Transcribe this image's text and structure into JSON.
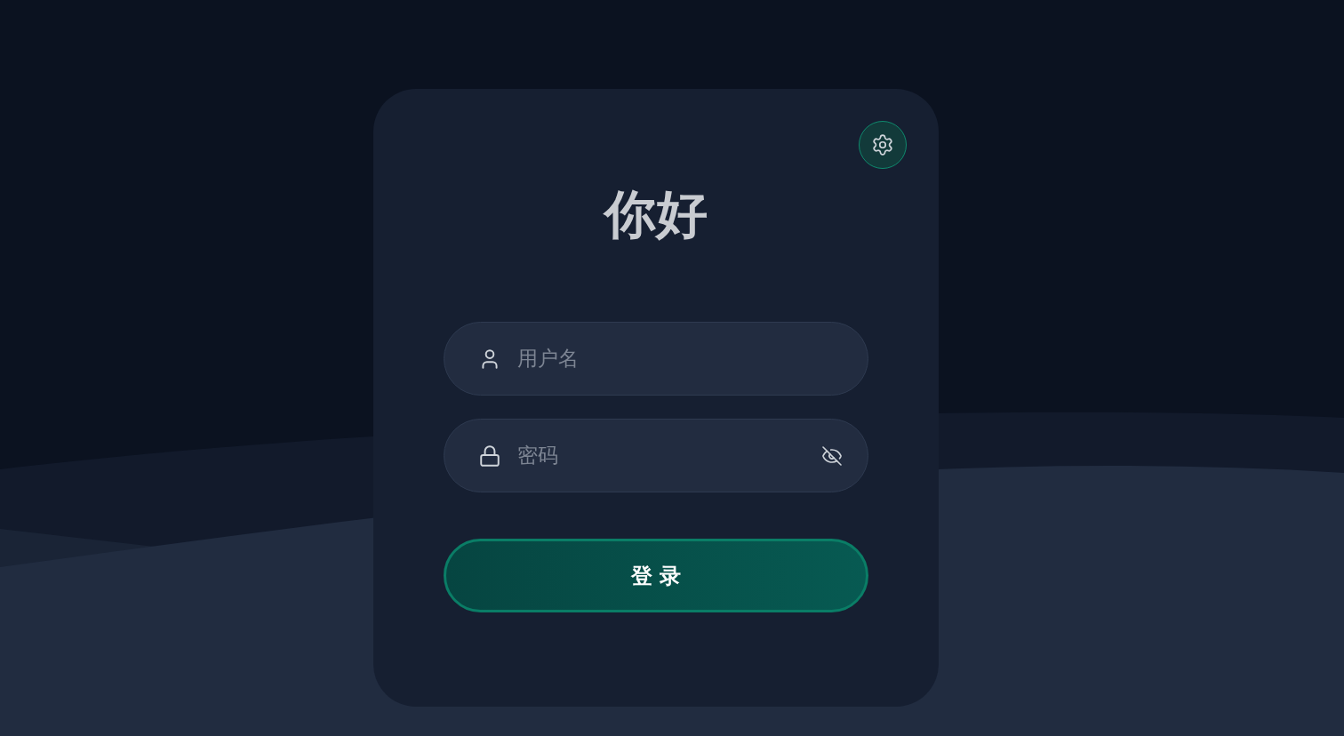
{
  "title": "你好",
  "fields": [
    {
      "kind": "text",
      "placeholder": "用户名"
    },
    {
      "kind": "password",
      "placeholder": "密码",
      "password_visible": false
    }
  ],
  "login_button": "登 录"
}
